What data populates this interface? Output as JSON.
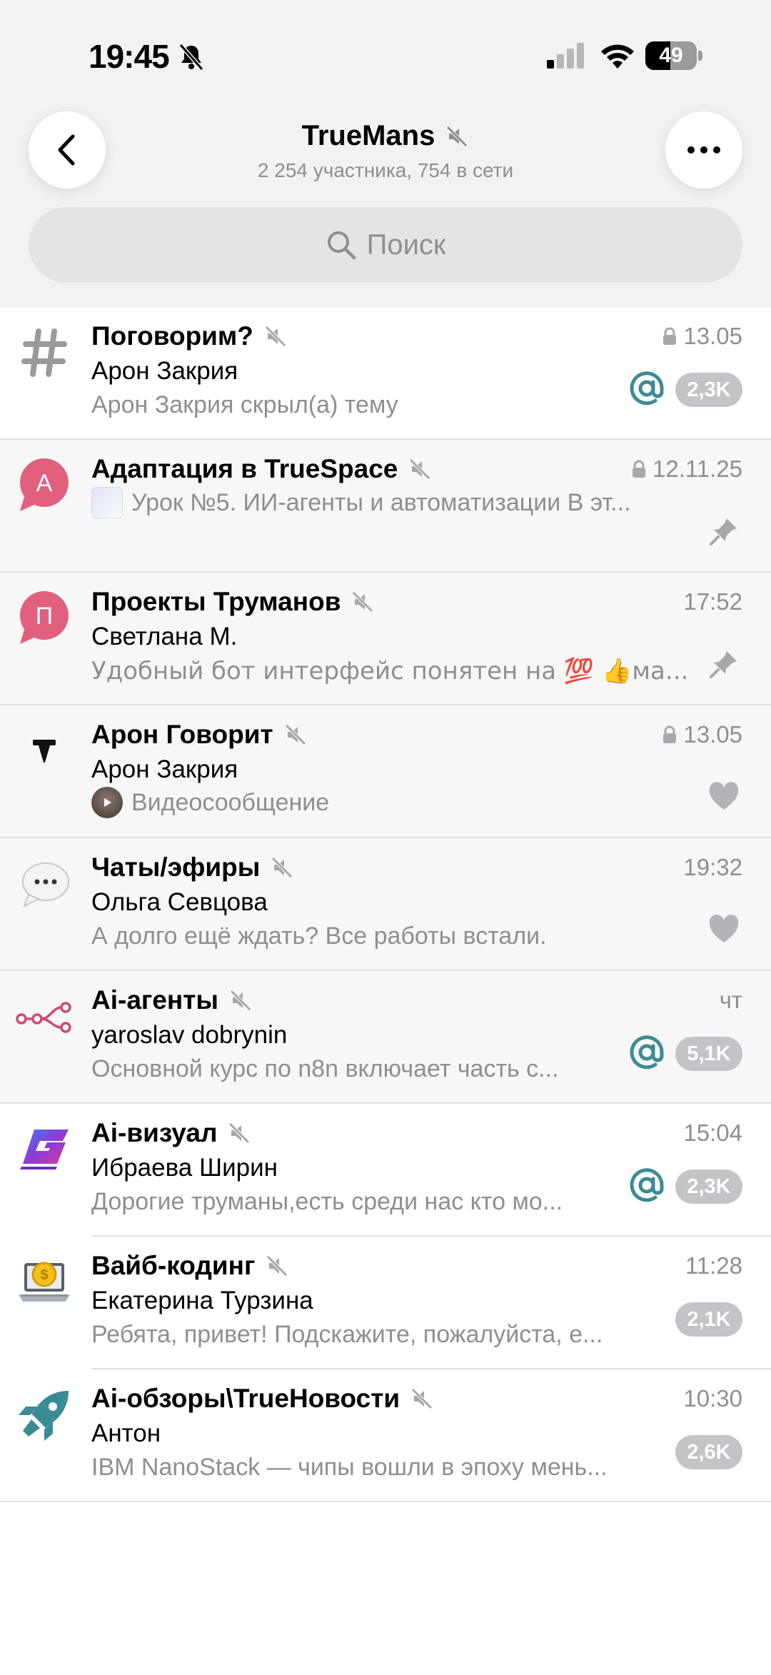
{
  "status_bar": {
    "time": "19:45",
    "battery": "49",
    "battery_fraction": 0.49
  },
  "header": {
    "title": "TrueMans",
    "subtitle": "2 254 участника, 754 в сети",
    "search_placeholder": "Поиск"
  },
  "colors": {
    "accent": "#3a8b94",
    "badge": "#c4c4c8",
    "secondary_text": "#8e8e93",
    "avatar_pink": "#e0607e"
  },
  "topics": [
    {
      "name": "Поговорим?",
      "time": "13.05",
      "locked": true,
      "sender": "Арон Закрия",
      "preview": "Арон Закрия скрыл(а) тему",
      "mention": true,
      "badge": "2,3K",
      "icon": "hash-icon"
    },
    {
      "name": "Адаптация в TrueSpace",
      "time": "12.11.25",
      "locked": true,
      "sender": "",
      "preview": "Урок №5. ИИ-агенты и автоматизации В эт...",
      "avatar_letter": "А",
      "pinned": true,
      "icon": "pin-icon"
    },
    {
      "name": "Проекты Труманов",
      "time": "17:52",
      "sender": "Светлана М.",
      "preview": "Удобный бот интерфейс понятен на 💯 👍ма...",
      "avatar_letter": "П",
      "pinned": true,
      "icon": "pin-icon"
    },
    {
      "name": "Арон Говорит",
      "time": "13.05",
      "locked": true,
      "sender": "Арон Закрия",
      "preview": "Видеосообщение",
      "icon": "heart-icon"
    },
    {
      "name": "Чаты/эфиры",
      "time": "19:32",
      "sender": "Ольга Севцова",
      "preview": "А долго ещё ждать? Все работы встали.",
      "icon": "heart-icon"
    },
    {
      "name": "Ai-агенты",
      "time": "чт",
      "sender": "yaroslav dobrynin",
      "preview": "Основной курс по n8n включает часть с...",
      "mention": true,
      "badge": "5,1K"
    },
    {
      "name": "Ai-визуал",
      "time": "15:04",
      "sender": "Ибраева Ширин",
      "preview": "Дорогие труманы,есть среди нас кто мо...",
      "mention": true,
      "badge": "2,3K"
    },
    {
      "name": "Вайб-кодинг",
      "time": "11:28",
      "sender": "Екатерина Турзина",
      "preview": "Ребята, привет! Подскажите, пожалуйста, е...",
      "badge": "2,1K"
    },
    {
      "name": "Ai-обзоры\\TrueНовости",
      "time": "10:30",
      "sender": "Антон",
      "preview": "IBM NanoStack — чипы вошли в эпоху мень...",
      "badge": "2,6K"
    }
  ]
}
